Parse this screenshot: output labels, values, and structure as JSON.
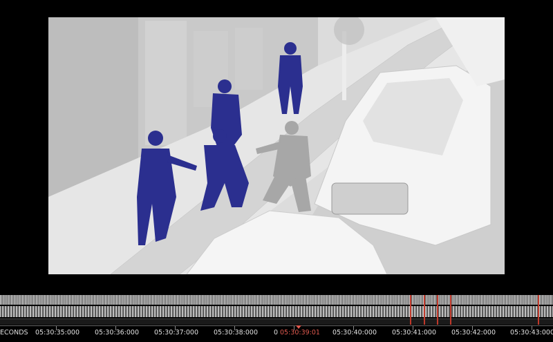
{
  "timeline": {
    "units_label": "ECONDS",
    "ticks": [
      {
        "label": "05:30:35:000"
      },
      {
        "label": "05:30:36:000"
      },
      {
        "label": "05:30:37:000"
      },
      {
        "label": "05:30:38:000"
      },
      {
        "label": "0"
      },
      {
        "label": "05:30:40:000"
      },
      {
        "label": "05:30:41:000"
      },
      {
        "label": "05:30:42:000"
      },
      {
        "label": "05:30:43:000"
      }
    ],
    "current_time": "05:30:39:01",
    "marker_color": "#c0392b",
    "current_color": "#e05a4f"
  },
  "scene": {
    "officer_color": "#2b2f8f",
    "civilian_color": "#a7a7a7",
    "ground_color": "#dcdcdc"
  }
}
